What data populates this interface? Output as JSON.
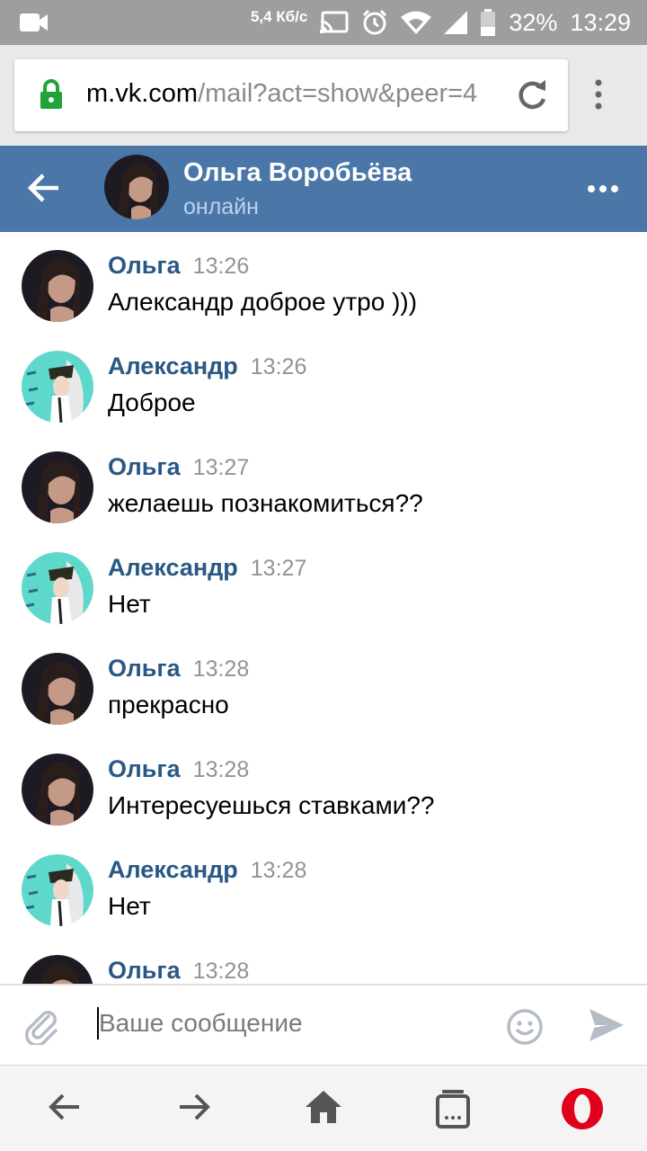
{
  "status_bar": {
    "network_speed_line1": "5,4 Кб/с",
    "battery": "32%",
    "time": "13:29",
    "icons": [
      "camera-icon",
      "cast-icon",
      "alarm-icon",
      "wifi-icon",
      "signal-icon",
      "battery-icon"
    ]
  },
  "browser": {
    "url_host": "m.vk.com",
    "url_path": "/mail?act=show&peer=4",
    "icons": [
      "lock-icon",
      "reload-icon",
      "more-vert-icon"
    ]
  },
  "chat_header": {
    "name": "Ольга Воробьёва",
    "status": "онлайн"
  },
  "messages": [
    {
      "author": "Ольга",
      "time": "13:26",
      "text": "Александр доброе утро )))"
    },
    {
      "author": "Александр",
      "time": "13:26",
      "text": "Доброе"
    },
    {
      "author": "Ольга",
      "time": "13:27",
      "text": "желаешь познакомиться??"
    },
    {
      "author": "Александр",
      "time": "13:27",
      "text": "Нет"
    },
    {
      "author": "Ольга",
      "time": "13:28",
      "text": "прекрасно"
    },
    {
      "author": "Ольга",
      "time": "13:28",
      "text": "Интересуешься ставками??"
    },
    {
      "author": "Александр",
      "time": "13:28",
      "text": "Нет"
    },
    {
      "author": "Ольга",
      "time": "13:28",
      "text": ""
    }
  ],
  "compose": {
    "placeholder": "Ваше сообщение",
    "value": ""
  },
  "colors": {
    "header": "#4a76a8",
    "author": "#2a5885",
    "status_bar": "#9e9e9e",
    "opera": "#e0001b"
  }
}
